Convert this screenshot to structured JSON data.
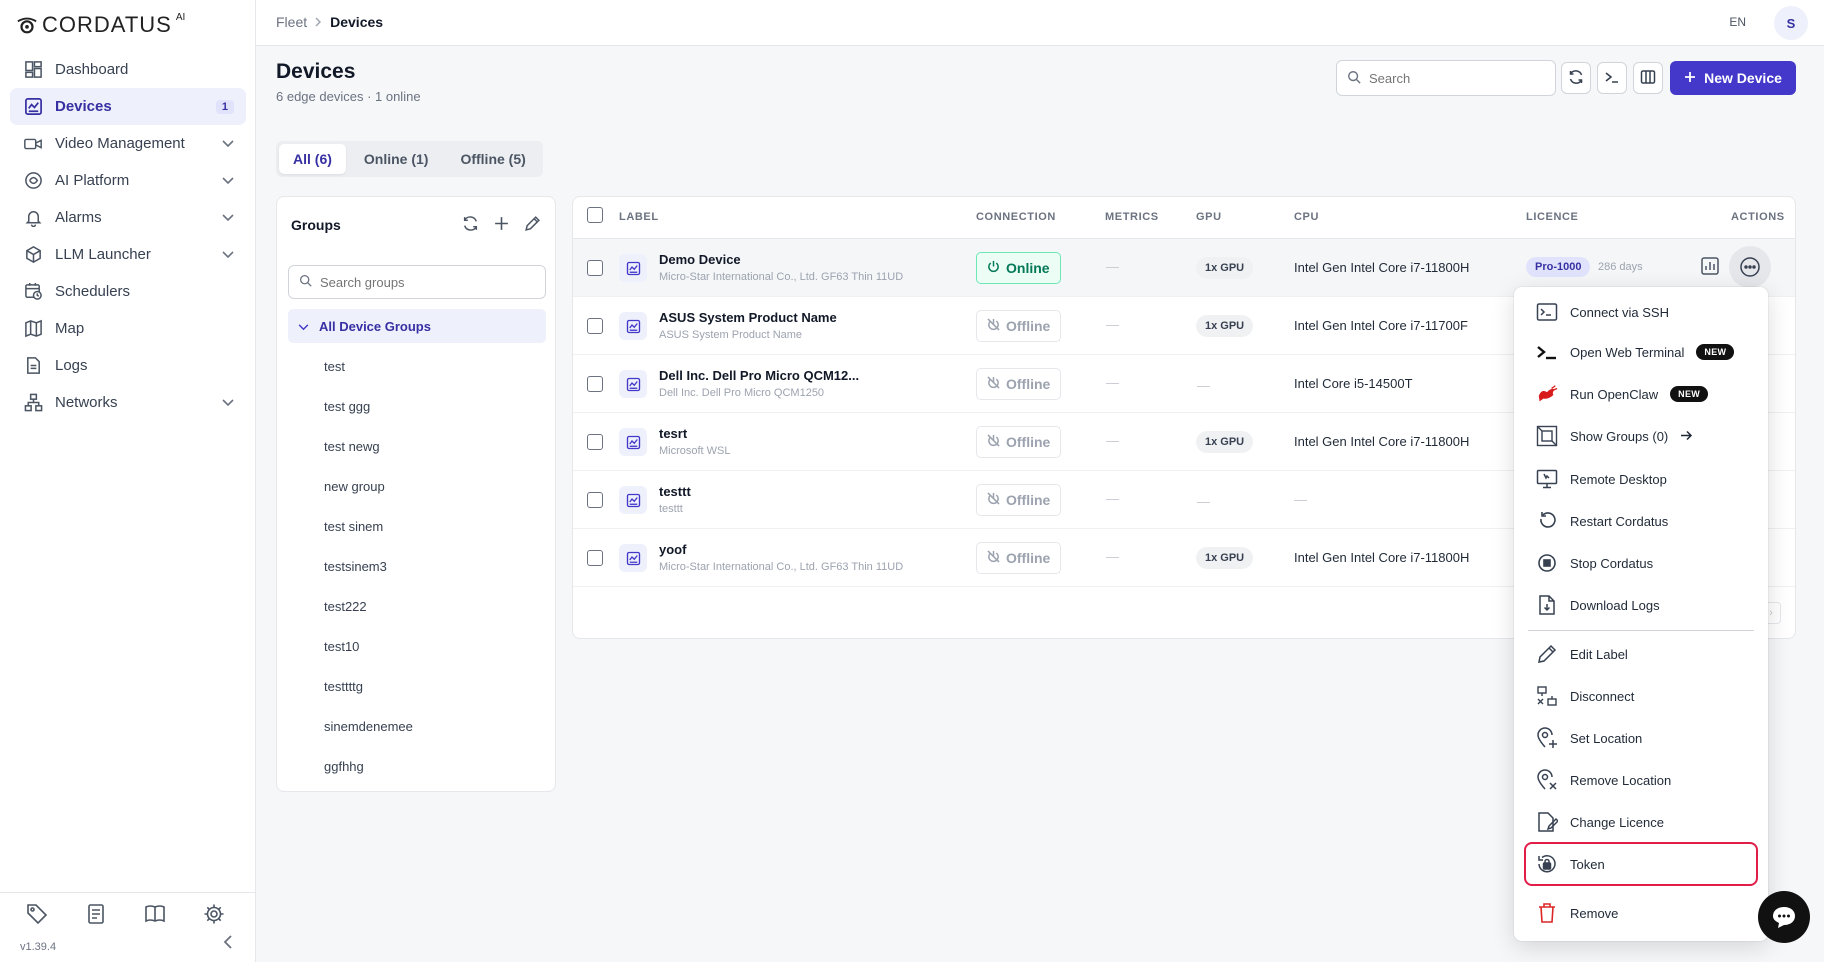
{
  "app": {
    "logo_text": "CORDATUS",
    "logo_sup": "AI",
    "version": "v1.39.4"
  },
  "sidebar": {
    "items": [
      {
        "label": "Dashboard",
        "icon": "dashboard-icon"
      },
      {
        "label": "Devices",
        "icon": "devices-icon",
        "badge": "1",
        "active": true
      },
      {
        "label": "Video Management",
        "icon": "video-icon",
        "expandable": true
      },
      {
        "label": "AI Platform",
        "icon": "ai-platform-icon",
        "expandable": true
      },
      {
        "label": "Alarms",
        "icon": "bell-icon",
        "expandable": true
      },
      {
        "label": "LLM Launcher",
        "icon": "cube-icon",
        "expandable": true
      },
      {
        "label": "Schedulers",
        "icon": "scheduler-icon"
      },
      {
        "label": "Map",
        "icon": "map-icon"
      },
      {
        "label": "Logs",
        "icon": "logs-icon"
      },
      {
        "label": "Networks",
        "icon": "network-icon",
        "expandable": true
      }
    ]
  },
  "topbar": {
    "breadcrumb": [
      "Fleet",
      "Devices"
    ],
    "lang": "EN",
    "avatar": "S"
  },
  "header": {
    "title": "Devices",
    "subtitle": "6 edge devices · 1 online",
    "search_placeholder": "Search",
    "new_device_label": "New Device"
  },
  "tabs": [
    "All (6)",
    "Online (1)",
    "Offline (5)"
  ],
  "groups": {
    "title": "Groups",
    "search_placeholder": "Search groups",
    "all_label": "All Device Groups",
    "items": [
      "test",
      "test ggg",
      "test newg",
      "new group",
      "test sinem",
      "testsinem3",
      "test222",
      "test10",
      "testtttg",
      "sinemdenemee",
      "ggfhhg"
    ]
  },
  "table": {
    "headers": {
      "label": "LABEL",
      "connection": "CONNECTION",
      "metrics": "METRICS",
      "gpu": "GPU",
      "cpu": "CPU",
      "licence": "LICENCE",
      "actions": "ACTIONS"
    },
    "rows": [
      {
        "name": "Demo Device",
        "sub": "Micro-Star International Co., Ltd. GF63 Thin 11UD",
        "status": "Online",
        "metrics": "—",
        "gpu": "1x GPU",
        "cpu": "Intel Gen Intel Core i7-11800H",
        "licence": "Pro-1000",
        "days": "286 days"
      },
      {
        "name": "ASUS System Product Name",
        "sub": "ASUS System Product Name",
        "status": "Offline",
        "metrics": "—",
        "gpu": "1x GPU",
        "cpu": "Intel Gen Intel Core i7-11700F"
      },
      {
        "name": "Dell Inc. Dell Pro Micro QCM12...",
        "sub": "Dell Inc. Dell Pro Micro QCM1250",
        "status": "Offline",
        "metrics": "—",
        "gpu": "—",
        "cpu": "Intel Core i5-14500T"
      },
      {
        "name": "tesrt",
        "sub": "Microsoft WSL",
        "status": "Offline",
        "metrics": "—",
        "gpu": "1x GPU",
        "cpu": "Intel Gen Intel Core i7-11800H"
      },
      {
        "name": "testtt",
        "sub": "testtt",
        "status": "Offline",
        "metrics": "—",
        "gpu": "—",
        "cpu": "—"
      },
      {
        "name": "yoof",
        "sub": "Micro-Star International Co., Ltd. GF63 Thin 11UD",
        "status": "Offline",
        "metrics": "—",
        "gpu": "1x GPU",
        "cpu": "Intel Gen Intel Core i7-11800H"
      }
    ]
  },
  "menu": {
    "new_badge": "NEW",
    "items": [
      {
        "label": "Connect via SSH",
        "icon": "ssh-icon"
      },
      {
        "label": "Open Web Terminal",
        "icon": "terminal-icon",
        "new": true
      },
      {
        "label": "Run OpenClaw",
        "icon": "openclaw-icon",
        "new": true
      },
      {
        "label": "Show Groups (0)",
        "icon": "groups-icon",
        "arrow": true
      },
      {
        "label": "Remote Desktop",
        "icon": "remote-desktop-icon"
      },
      {
        "label": "Restart Cordatus",
        "icon": "restart-icon"
      },
      {
        "label": "Stop Cordatus",
        "icon": "stop-icon"
      },
      {
        "label": "Download Logs",
        "icon": "download-logs-icon"
      },
      {
        "label": "Edit Label",
        "icon": "pencil-icon"
      },
      {
        "label": "Disconnect",
        "icon": "disconnect-icon"
      },
      {
        "label": "Set Location",
        "icon": "set-location-icon"
      },
      {
        "label": "Remove Location",
        "icon": "remove-location-icon"
      },
      {
        "label": "Change Licence",
        "icon": "change-licence-icon"
      },
      {
        "label": "Token",
        "icon": "token-icon",
        "focused": true
      },
      {
        "label": "Remove",
        "icon": "trash-icon",
        "danger": true
      }
    ]
  },
  "colors": {
    "accent": "#4338ca",
    "online": "#047857",
    "danger": "#dc2626",
    "focus": "#e11d48"
  }
}
